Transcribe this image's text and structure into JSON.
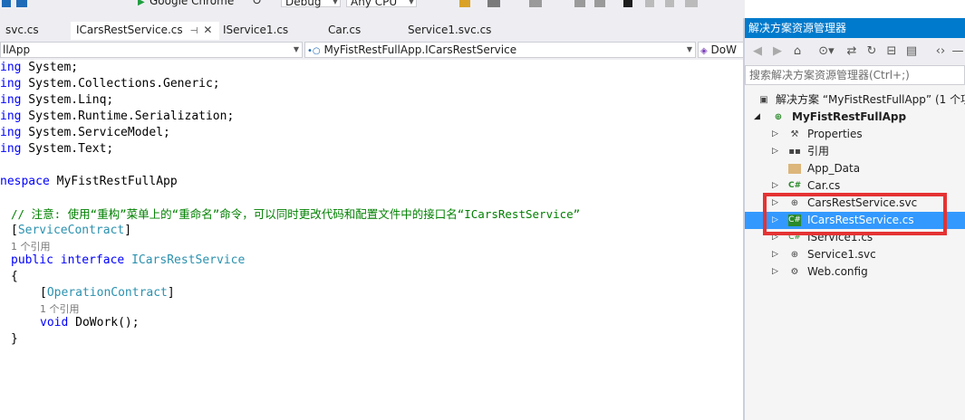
{
  "toolbar": {
    "browser_label": "Google Chrome",
    "config_value": "Debug",
    "platform_value": "Any CPU"
  },
  "tabs": [
    {
      "label": "svc.cs",
      "active": false
    },
    {
      "label": "ICarsRestService.cs",
      "active": true,
      "pin": "⊣",
      "close": "✕"
    },
    {
      "label": "IService1.cs",
      "active": false
    },
    {
      "label": "Car.cs",
      "active": false
    },
    {
      "label": "Service1.svc.cs",
      "active": false
    }
  ],
  "navbar": {
    "project": "llApp",
    "type": "MyFistRestFullApp.ICarsRestService",
    "member": "DoW"
  },
  "code": {
    "l1": {
      "kw": "ing",
      "rest": " System;"
    },
    "l2": {
      "kw": "ing",
      "rest": " System.Collections.Generic;"
    },
    "l3": {
      "kw": "ing",
      "rest": " System.Linq;"
    },
    "l4": {
      "kw": "ing",
      "rest": " System.Runtime.Serialization;"
    },
    "l5": {
      "kw": "ing",
      "rest": " System.ServiceModel;"
    },
    "l6": {
      "kw": "ing",
      "rest": " System.Text;"
    },
    "l8": {
      "kw": "nespace",
      "rest": " MyFistRestFullApp"
    },
    "comment": "// 注意: 使用“重构”菜单上的“重命名”命令，可以同时更改代码和配置文件中的接口名“ICarsRestService”",
    "attr_open": "[",
    "attr1": "ServiceContract",
    "attr_close": "]",
    "ref1": "1 个引用",
    "l_public": "public",
    "l_interface": "interface",
    "l_name": "ICarsRestService",
    "brace_open": "{",
    "attr2": "OperationContract",
    "ref2": "1 个引用",
    "l_void": "void",
    "l_method": " DoWork();",
    "brace_close": "}"
  },
  "solution_explorer": {
    "title": "解决方案资源管理器",
    "search_placeholder": "搜索解决方案资源管理器(Ctrl+;)",
    "solution": "解决方案 “MyFistRestFullApp” (1 个项",
    "project": "MyFistRestFullApp",
    "items": [
      {
        "label": "Properties",
        "icon": "wrench-icon"
      },
      {
        "label": "引用",
        "icon": "references-icon"
      },
      {
        "label": "App_Data",
        "icon": "folder-icon"
      },
      {
        "label": "Car.cs",
        "icon": "csharp-icon"
      },
      {
        "label": "CarsRestService.svc",
        "icon": "service-icon"
      },
      {
        "label": "ICarsRestService.cs",
        "icon": "interface-icon",
        "selected": true
      },
      {
        "label": "IService1.cs",
        "icon": "interface-icon"
      },
      {
        "label": "Service1.svc",
        "icon": "service-icon"
      },
      {
        "label": "Web.config",
        "icon": "config-icon"
      }
    ]
  },
  "colors": {
    "accent": "#007acc",
    "selection": "#3399ff",
    "highlight_box": "#e53333",
    "keyword": "#0000ff",
    "type": "#2b91af",
    "comment": "#008000"
  }
}
